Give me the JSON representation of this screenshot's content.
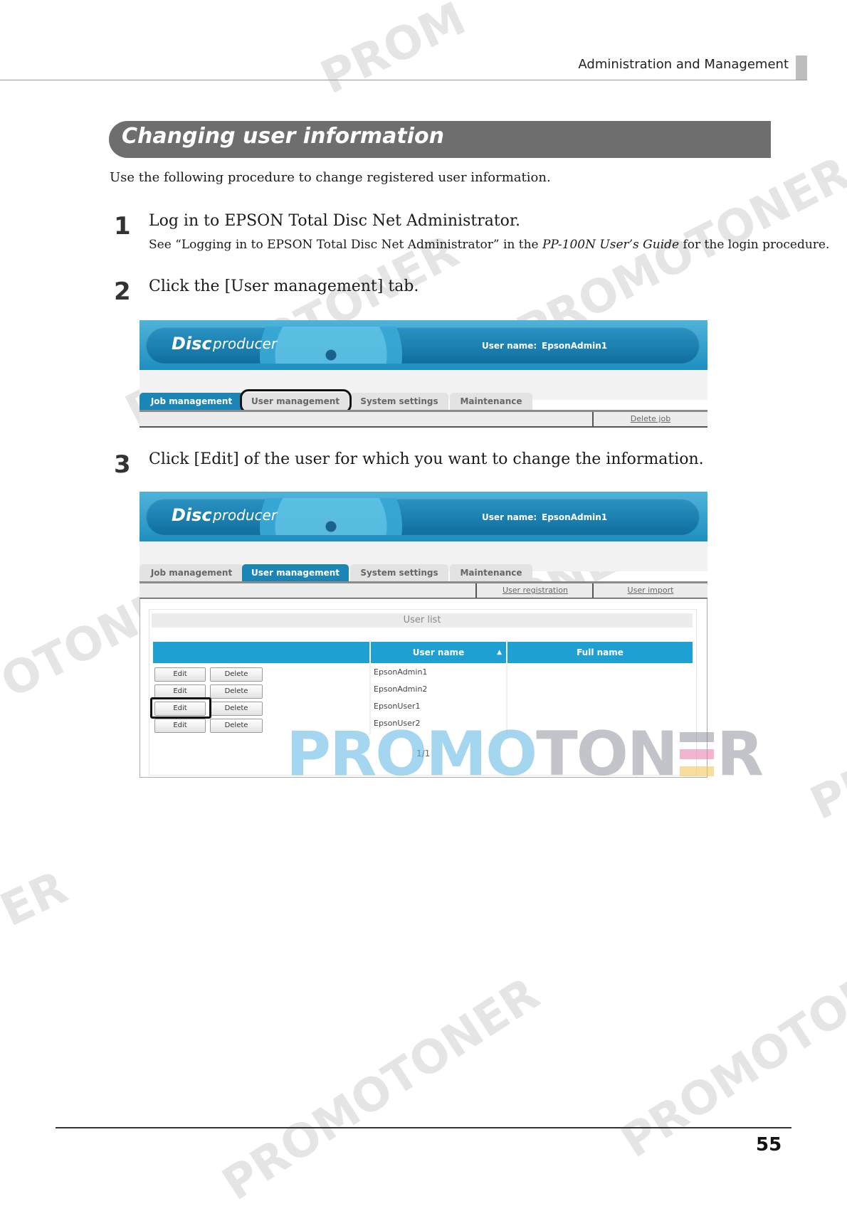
{
  "header": {
    "title": "Administration and Management"
  },
  "section": {
    "title": "Changing user information",
    "intro": "Use the following procedure to change registered user information."
  },
  "steps": [
    {
      "number": "1",
      "text": "Log in to EPSON Total Disc Net Administrator.",
      "sub_before": "See “Logging in to EPSON Total Disc Net Administrator” in the ",
      "sub_italic": "PP-100N User’s Guide",
      "sub_after": " for the login procedure."
    },
    {
      "number": "2",
      "text": "Click the [User management] tab."
    },
    {
      "number": "3",
      "text": "Click [Edit] of the user for which you want to change the information."
    }
  ],
  "app": {
    "logo_disc": "Disc",
    "logo_producer": "producer",
    "user_label": "User name:",
    "user_value": "EpsonAdmin1",
    "tabs": [
      "Job management",
      "User management",
      "System settings",
      "Maintenance"
    ]
  },
  "screenshot1": {
    "active_tab": "Job management",
    "highlighted_tab": "User management",
    "sublink": "Delete job"
  },
  "screenshot2": {
    "active_tab": "User management",
    "sublinks": [
      "User registration",
      "User import"
    ],
    "list_title": "User list",
    "columns": [
      "User name",
      "Full name"
    ],
    "sort_indicator": "▲",
    "edit_label": "Edit",
    "delete_label": "Delete",
    "rows": [
      {
        "user_name": "EpsonAdmin1",
        "full_name": ""
      },
      {
        "user_name": "EpsonAdmin2",
        "full_name": ""
      },
      {
        "user_name": "EpsonUser1",
        "full_name": ""
      },
      {
        "user_name": "EpsonUser2",
        "full_name": ""
      }
    ],
    "highlighted_row": 2,
    "pager": "1/1"
  },
  "watermark": {
    "text": "PROMOTONER",
    "part_a": "PROMO",
    "part_b": "TON",
    "part_c": "R",
    "repeat": [
      "PROM",
      "PROMOTONER",
      "PROMOTONER",
      "PROMOTONER",
      "OTONER",
      "PR",
      "ER",
      "PROMOTONER",
      "PROMOTONER"
    ],
    "colors": {
      "blue": "#5ab4e1",
      "gray": "#787d87"
    }
  },
  "footer": {
    "page_number": "55"
  }
}
